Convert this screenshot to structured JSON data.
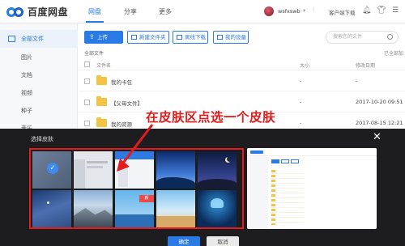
{
  "header": {
    "logo_text": "百度网盘",
    "tabs": [
      {
        "label": "网盘",
        "active": true
      },
      {
        "label": "分享",
        "active": false
      },
      {
        "label": "更多",
        "active": false
      }
    ],
    "username": "wsfxswb",
    "client_download": "客户端下载"
  },
  "sidebar": {
    "items": [
      {
        "label": "全部文件",
        "active": true
      },
      {
        "label": "图片"
      },
      {
        "label": "文档"
      },
      {
        "label": "视频"
      },
      {
        "label": "种子"
      },
      {
        "label": "音乐"
      }
    ]
  },
  "toolbar": {
    "upload": "上传",
    "new_folder": "新建文件夹",
    "offline_download": "离线下载",
    "my_devices": "我的设备",
    "search_placeholder": "搜索您的文件"
  },
  "file_list": {
    "breadcrumb": "全部文件",
    "loaded_status": "已全部加",
    "columns": {
      "name": "文件名",
      "size": "大小",
      "modified": "修改日期"
    },
    "rows": [
      {
        "name": "我的卡包",
        "size": "-",
        "modified": "-"
      },
      {
        "name": "【父母文件】",
        "size": "-",
        "modified": "2017-10-20 09:51"
      },
      {
        "name": "我的资源",
        "size": "-",
        "modified": "2017-08-15 12:21"
      }
    ]
  },
  "dialog": {
    "title": "选择皮肤",
    "confirm": "确定",
    "cancel": "取消",
    "vip_badge": "新"
  },
  "annotation": {
    "text": "在皮肤区点选一个皮肤",
    "color": "#e41b1b"
  },
  "colors": {
    "accent": "#2a7be6",
    "highlight": "#e41b1b"
  }
}
